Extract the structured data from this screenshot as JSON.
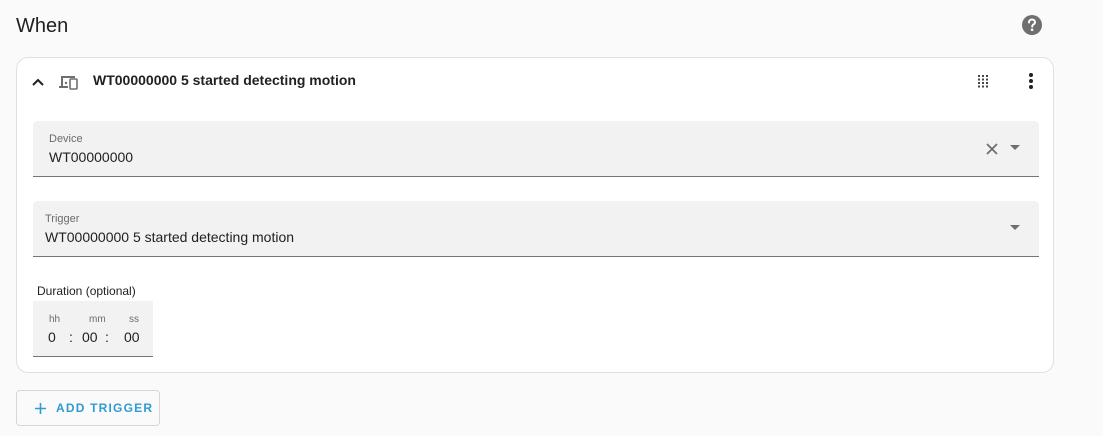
{
  "section": {
    "title": "When",
    "help_icon": "help-circle-icon"
  },
  "trigger_card": {
    "title": "WT00000000 5 started detecting motion",
    "icons": [
      "chevron-up-icon",
      "devices-icon",
      "drag-handle-icon",
      "more-vertical-icon"
    ],
    "device_field": {
      "label": "Device",
      "value": "WT00000000"
    },
    "trigger_field": {
      "label": "Trigger",
      "value": "WT00000000 5 started detecting motion"
    },
    "duration": {
      "label": "Duration (optional)",
      "hours_label": "hh",
      "minutes_label": "mm",
      "seconds_label": "ss",
      "hours": "0",
      "minutes": "00",
      "seconds": "00",
      "separator": ":"
    }
  },
  "add_trigger": {
    "label": "ADD TRIGGER",
    "icon": "plus-icon"
  },
  "colors": {
    "accent": "#2e9bd4",
    "background": "#fafafa",
    "field_background": "#f2f2f2",
    "icon_gray": "#6f6f6f"
  }
}
